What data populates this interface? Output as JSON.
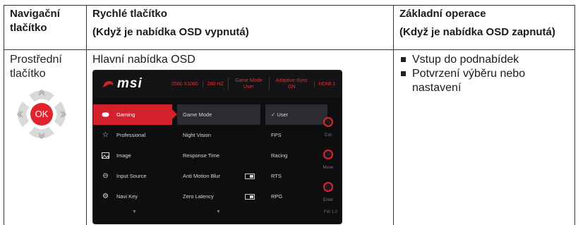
{
  "table": {
    "header": {
      "col1": [
        "Navigační",
        "tlačítko"
      ],
      "col2": [
        "Rychlé tlačítko",
        "(Když je nabídka OSD vypnutá)"
      ],
      "col3": [
        "Základní operace",
        "(Když je nabídka OSD zapnutá)"
      ]
    },
    "row": {
      "button_name": [
        "Prostřední",
        "tlačítko"
      ],
      "ok_label": "OK",
      "quick_function": "Hlavní nabídka OSD",
      "operations": [
        "Vstup do podnabídek",
        "Potvrzení výběru nebo nastavení"
      ]
    }
  },
  "osd": {
    "logo": "msi",
    "status": [
      "2560 X1080",
      "200 HZ",
      "Game Mode User",
      "Adaptive-Sync ON",
      "HDMI 1"
    ],
    "menu": [
      {
        "label": "Gaming",
        "icon": "gamepad-icon",
        "active": true
      },
      {
        "label": "Professional",
        "icon": "star-icon",
        "active": false
      },
      {
        "label": "Image",
        "icon": "image-icon",
        "active": false
      },
      {
        "label": "Input Source",
        "icon": "input-icon",
        "active": false
      },
      {
        "label": "Navi Key",
        "icon": "navi-key-icon",
        "active": false
      }
    ],
    "submenu": [
      {
        "label": "Game Mode",
        "toggle": false
      },
      {
        "label": "Night Vision",
        "toggle": false
      },
      {
        "label": "Response Time",
        "toggle": false
      },
      {
        "label": "Anti Motion Blur",
        "toggle": true
      },
      {
        "label": "Zero Latency",
        "toggle": true
      }
    ],
    "options": [
      "✓ User",
      "FPS",
      "Racing",
      "RTS",
      "RPG"
    ],
    "side": [
      "Exit",
      "Move",
      "Enter"
    ],
    "firmware": "FW 1.0",
    "accent": "#d4202c"
  }
}
